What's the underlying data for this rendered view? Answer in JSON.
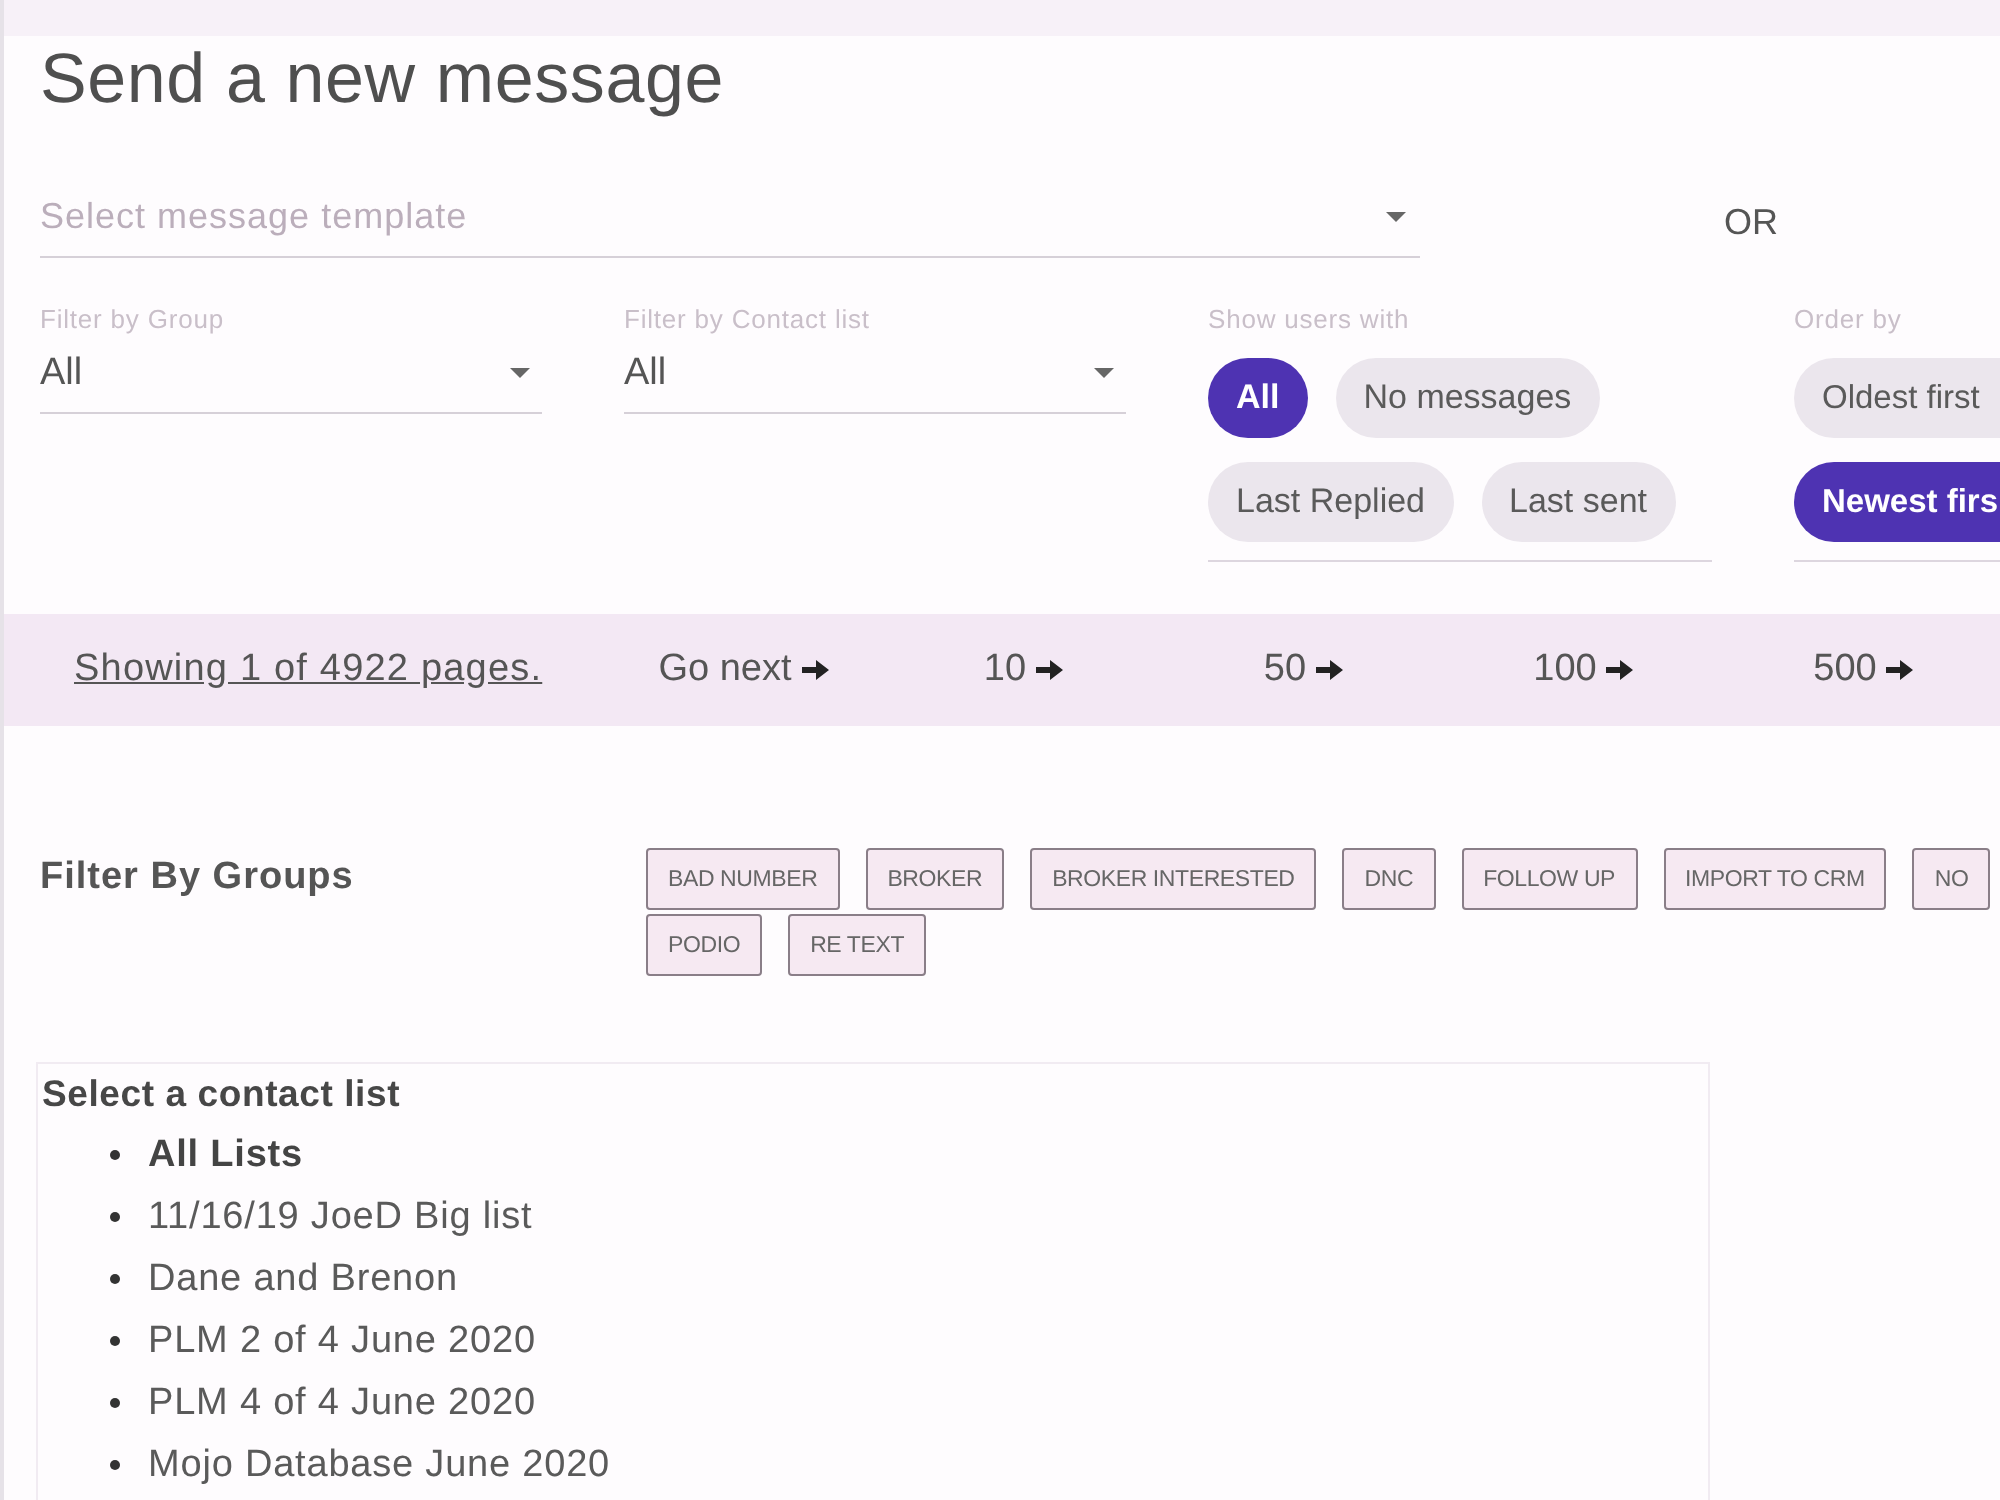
{
  "page": {
    "title": "Send a new message"
  },
  "template_select": {
    "placeholder": "Select message template"
  },
  "or_label": "OR",
  "filters": [
    {
      "label": "Filter by Group",
      "value": "All"
    },
    {
      "label": "Filter by Contact list",
      "value": "All"
    }
  ],
  "show_users_with": {
    "label": "Show users with",
    "options": [
      {
        "label": "All",
        "selected": true
      },
      {
        "label": "No messages",
        "selected": false
      },
      {
        "label": "Last Replied",
        "selected": false
      },
      {
        "label": "Last sent",
        "selected": false
      }
    ]
  },
  "order_by": {
    "label": "Order by",
    "options": [
      {
        "label": "Oldest first",
        "selected": false
      },
      {
        "label": "Newest firs",
        "selected": true
      }
    ]
  },
  "pagination": {
    "status": "Showing 1 of 4922 pages.",
    "steps": [
      "Go next",
      "10",
      "50",
      "100",
      "500"
    ]
  },
  "group_filter": {
    "label": "Filter By Groups",
    "tags": [
      "BAD NUMBER",
      "BROKER",
      "BROKER INTERESTED",
      "DNC",
      "FOLLOW UP",
      "IMPORT TO CRM",
      "NO",
      "PODIO",
      "RE TEXT"
    ]
  },
  "contact_lists": {
    "title": "Select a contact list",
    "items": [
      {
        "label": "All Lists",
        "selected": true
      },
      {
        "label": "11/16/19 JoeD Big list",
        "selected": false
      },
      {
        "label": "Dane and Brenon",
        "selected": false
      },
      {
        "label": "PLM 2 of 4 June 2020",
        "selected": false
      },
      {
        "label": "PLM 4 of 4 June 2020",
        "selected": false
      },
      {
        "label": "Mojo Database June 2020",
        "selected": false
      }
    ]
  }
}
